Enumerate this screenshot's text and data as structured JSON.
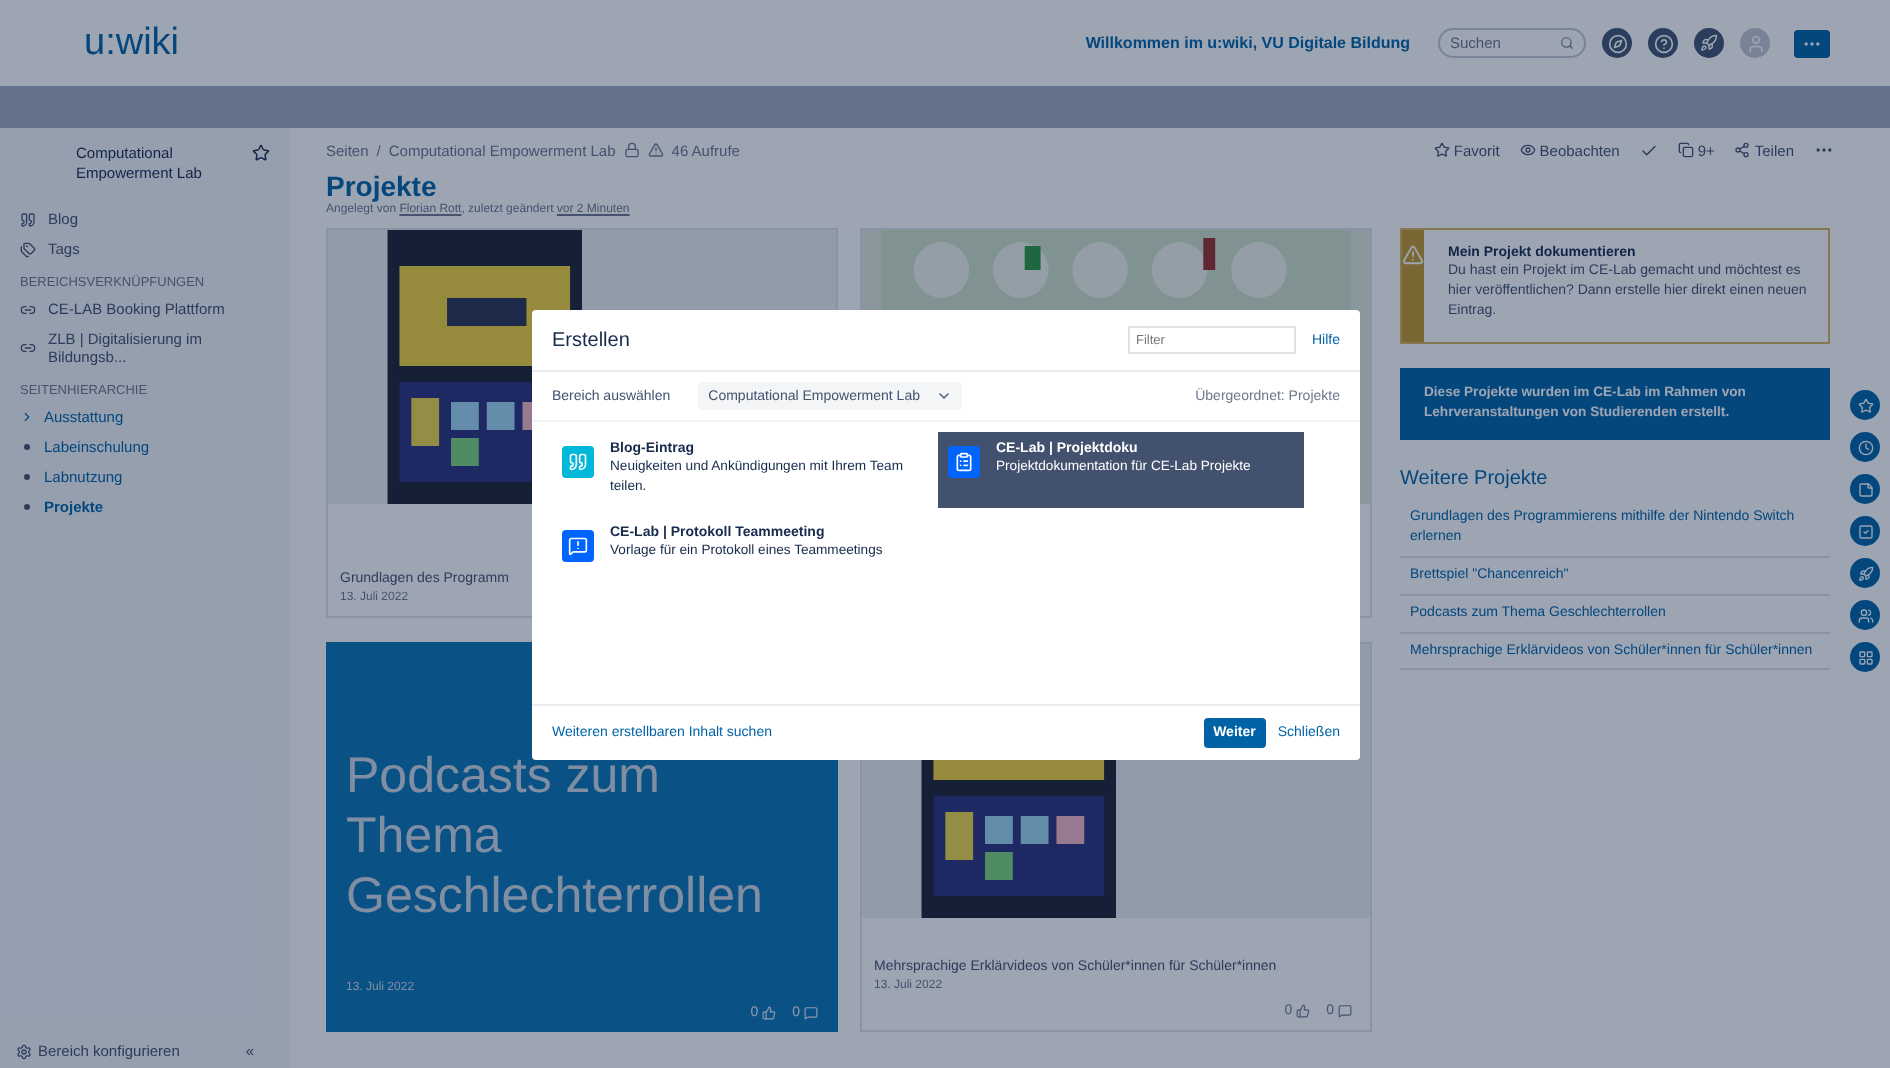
{
  "header": {
    "logo": "u:wiki",
    "welcome": "Willkommen im u:wiki, VU Digitale Bildung",
    "search": {
      "placeholder": "Suchen"
    }
  },
  "sidebar": {
    "space_name": "Computational Empowerment Lab",
    "nav": [
      {
        "kind": "blog",
        "label": "Blog"
      },
      {
        "kind": "tags",
        "label": "Tags"
      }
    ],
    "links_heading": "BEREICHSVERKNÜPFUNGEN",
    "links": [
      "CE-LAB Booking Plattform",
      "ZLB | Digitalisierung im Bildungsb..."
    ],
    "hierarchy_heading": "SEITENHIERARCHIE",
    "tree": [
      {
        "kind": "branch",
        "label": "Ausstattung",
        "selected": false
      },
      {
        "kind": "leaf",
        "label": "Labeinschulung",
        "selected": false
      },
      {
        "kind": "leaf",
        "label": "Labnutzung",
        "selected": false
      },
      {
        "kind": "leaf",
        "label": "Projekte",
        "selected": true
      }
    ],
    "configure": "Bereich konfigurieren",
    "collapse": "«"
  },
  "page": {
    "breadcrumb": {
      "items": [
        "Seiten",
        "Computational Empowerment Lab"
      ],
      "separator": "/"
    },
    "views": "46 Aufrufe",
    "title": "Projekte",
    "byline": [
      {
        "text": "Angelegt von ",
        "link": false
      },
      {
        "text": "Florian Rott",
        "link": true
      },
      {
        "text": ", zuletzt geändert ",
        "link": false
      },
      {
        "text": "vor 2 Minuten",
        "link": true
      }
    ],
    "actions": [
      {
        "kind": "star",
        "label": "Favorit"
      },
      {
        "kind": "watch",
        "label": "Beobachten"
      },
      {
        "kind": "check"
      },
      {
        "kind": "pages",
        "label": "9+"
      },
      {
        "kind": "share",
        "label": "Teilen"
      },
      {
        "kind": "more"
      }
    ]
  },
  "cards": [
    {
      "kind": "picture",
      "title": "Grundlagen des Programm",
      "date": "13. Juli 2022"
    },
    {
      "kind": "picture"
    },
    {
      "kind": "cover",
      "cover_text": "Podcasts zum Thema Geschlechterrollen",
      "date": "13. Juli 2022",
      "likes": "0",
      "comments": "0"
    },
    {
      "kind": "picture",
      "title": "Mehrsprachige Erklärvideos von Schüler*innen für Schüler*innen",
      "date": "13. Juli 2022",
      "likes": "0",
      "comments": "0"
    }
  ],
  "notice": {
    "title": "Mein Projekt dokumentieren",
    "text": "Du hast ein Projekt im CE-Lab gemacht und möchtest es hier veröffentlichen? Dann erstelle hier direkt einen neuen Eintrag."
  },
  "info": "Diese Projekte wurden im CE-Lab im Rahmen von Lehrveranstaltungen von Studierenden erstellt.",
  "more_heading": "Weitere Projekte",
  "more_links": [
    "Grundlagen des Programmierens mithilfe der Nintendo Switch erlernen",
    "Brettspiel \"Chancenreich\"",
    "Podcasts zum Thema Geschlechterrollen",
    "Mehrsprachige Erklärvideos von Schüler*innen für Schüler*innen"
  ],
  "modal": {
    "title": "Erstellen",
    "filter_placeholder": "Filter",
    "help": "Hilfe",
    "space_label": "Bereich auswählen",
    "space_value": "Computational Empowerment Lab",
    "parent": "Übergeordnet: Projekte",
    "templates": [
      {
        "kind": "blog",
        "name": "Blog-Eintrag",
        "description": "Neuigkeiten und Ankündigungen mit Ihrem Team teilen.",
        "selected": false
      },
      {
        "kind": "doc",
        "name": "CE-Lab | Projektdoku",
        "description": "Projektdokumentation für CE-Lab Projekte",
        "selected": true
      },
      {
        "kind": "meeting",
        "name": "CE-Lab | Protokoll Teammeeting",
        "description": "Vorlage für ein Protokoll eines Teammeetings",
        "selected": false
      }
    ],
    "more_link": "Weiteren erstellbaren Inhalt suchen",
    "primary": "Weiter",
    "close": "Schließen"
  }
}
